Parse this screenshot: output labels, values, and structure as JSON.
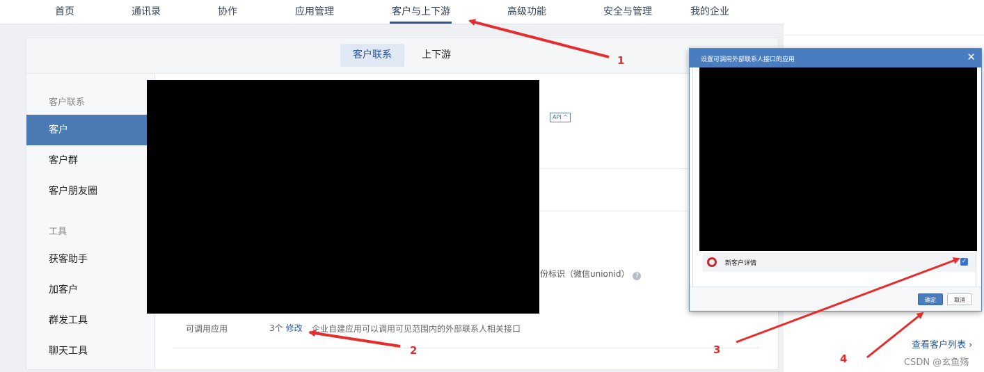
{
  "topnav": {
    "items": [
      "首页",
      "通讯录",
      "协作",
      "应用管理",
      "客户与上下游",
      "高级功能",
      "安全与管理",
      "我的企业"
    ]
  },
  "subtabs": {
    "active": "客户联系",
    "other": "上下游"
  },
  "sidebar": {
    "group1": "客户联系",
    "group1_items": [
      "客户",
      "客户群",
      "客户朋友圈"
    ],
    "group2": "工具",
    "group2_items": [
      "获客助手",
      "加客户",
      "群发工具",
      "聊天工具"
    ]
  },
  "content": {
    "api_badge": "API ^",
    "unionid_text": "份标识（微信unionid）",
    "qmark": "?",
    "row_label": "可调用应用",
    "row_count": "3个",
    "row_link": "修改",
    "row_desc": "企业自建应用可以调用可见范围内的外部联系人相关接口"
  },
  "right": {
    "view_list": "查看客户列表 ›",
    "watermark": "CSDN @玄鱼殇"
  },
  "dialog": {
    "title": "设置可调用外部联系人接口的应用",
    "close": "✕",
    "app_name": "新客户详情",
    "checked": "✓",
    "ok": "确定",
    "cancel": "取消"
  },
  "annotations": [
    "1",
    "2",
    "3",
    "4"
  ],
  "colors": {
    "accent": "#2b5797",
    "active_sidebar": "#4a79b4",
    "annotation": "#e52d2d",
    "dialog_title": "#4a7dc0"
  }
}
